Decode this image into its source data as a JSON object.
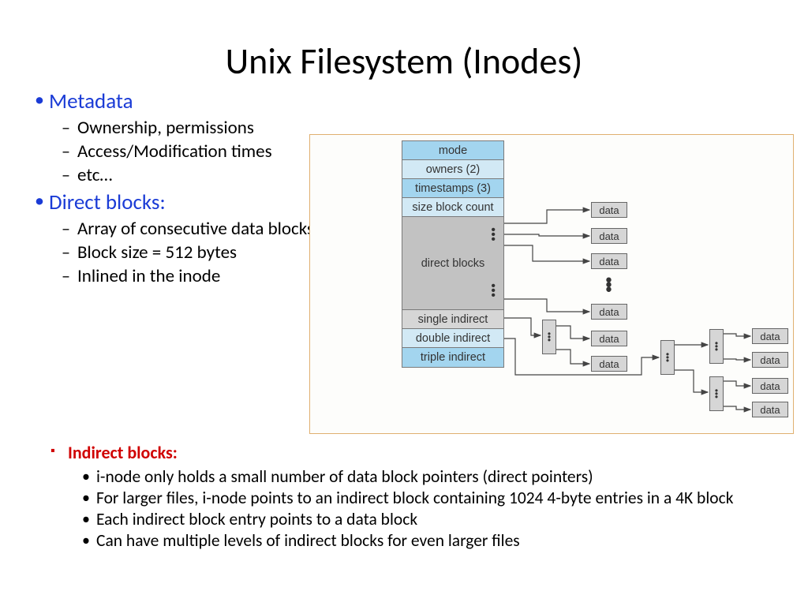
{
  "title": "Unix Filesystem (Inodes)",
  "sections": {
    "metadata": {
      "heading": "Metadata",
      "items": [
        "Ownership, permissions",
        "Access/Modification times",
        "etc…"
      ]
    },
    "direct": {
      "heading": "Direct blocks:",
      "items": [
        "Array of consecutive data blocks",
        "Block size = 512 bytes",
        "Inlined in the inode"
      ]
    },
    "indirect": {
      "heading": "Indirect blocks:",
      "items": [
        "i-node only holds a small number of data block pointers (direct pointers)",
        "For larger files, i-node points to an indirect block containing 1024 4-byte entries in a 4K block",
        "Each indirect block entry points to a data block",
        "Can have multiple levels of indirect blocks for even larger files"
      ]
    }
  },
  "diagram": {
    "inode_rows": {
      "mode": "mode",
      "owners": "owners (2)",
      "timestamps": "timestamps (3)",
      "size": "size block count",
      "direct": "direct blocks",
      "single": "single indirect",
      "double": "double indirect",
      "triple": "triple indirect"
    },
    "data_label": "data"
  }
}
